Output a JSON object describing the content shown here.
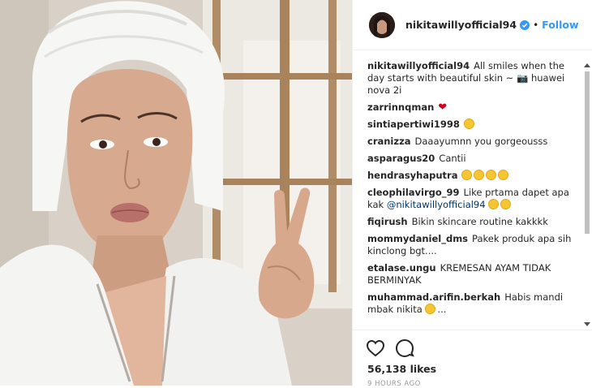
{
  "post": {
    "username": "nikitawillyofficial94",
    "follow_label": "Follow",
    "dot": "•",
    "likes": "56,138 likes",
    "time": "9 HOURS AGO"
  },
  "comments": [
    {
      "user": "nikitawillyofficial94",
      "text": "All smiles when the day starts with beautiful skin ~ 📷 huawei nova 2i"
    },
    {
      "user": "zarrinnqman",
      "text": "",
      "emoji": "heart"
    },
    {
      "user": "sintiapertiwi1998",
      "text": "",
      "emoji": "heart-eyes"
    },
    {
      "user": "cranizza",
      "text": "Daaayumnn you gorgeousss"
    },
    {
      "user": "asparagus20",
      "text": "Cantii"
    },
    {
      "user": "hendrasyhaputra",
      "text": "",
      "emoji": "four-faces"
    },
    {
      "user": "cleophilavirgo_99",
      "text": "Like prtama dapet apa kak",
      "mention": "@nikitawillyofficial94",
      "emoji": "two-faces"
    },
    {
      "user": "fiqirush",
      "text": "Bikin skincare routine kakkkk"
    },
    {
      "user": "mommydaniel_dms",
      "text": "Pakek produk apa sih kinclong bgt...."
    },
    {
      "user": "etalase.ungu",
      "text": "KREMESAN AYAM TIDAK BERMINYAK"
    },
    {
      "user": "muhammad.arifin.berkah",
      "text": "Habis mandi mbak nikita",
      "emoji": "smile",
      "suffix": "..."
    }
  ],
  "icons": [
    "heart-icon",
    "comment-icon",
    "verified-badge-icon"
  ],
  "colors": {
    "link": "#3897f0",
    "text": "#262626",
    "muted": "#999999",
    "border": "#efefef"
  }
}
